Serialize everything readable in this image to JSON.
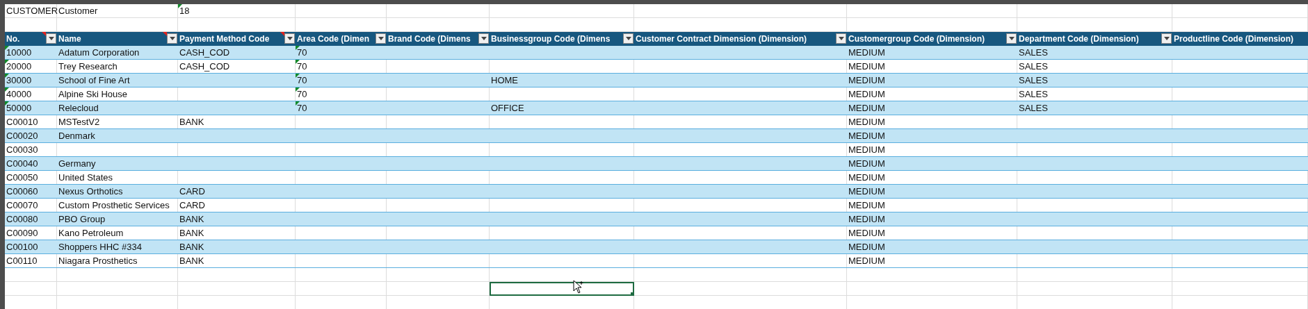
{
  "top_row": [
    {
      "text": "CUSTOMER",
      "flagged": false
    },
    {
      "text": "Customer",
      "flagged": false
    },
    {
      "text": "18",
      "flagged": true
    }
  ],
  "table": {
    "columns": [
      {
        "label": "No.",
        "filter": true,
        "comment": true
      },
      {
        "label": "Name",
        "filter": true,
        "comment": true
      },
      {
        "label": "Payment Method Code",
        "filter": true,
        "comment": true
      },
      {
        "label": "Area Code (Dimen",
        "filter": true,
        "comment": false
      },
      {
        "label": "Brand Code (Dimens",
        "filter": true,
        "comment": false
      },
      {
        "label": "Businessgroup Code (Dimens",
        "filter": true,
        "comment": false
      },
      {
        "label": "Customer Contract Dimension (Dimension)",
        "filter": true,
        "comment": false
      },
      {
        "label": "Customergroup Code (Dimension)",
        "filter": true,
        "comment": false
      },
      {
        "label": "Department Code (Dimension)",
        "filter": true,
        "comment": false
      },
      {
        "label": "Productline Code (Dimension)",
        "filter": false,
        "comment": false
      }
    ],
    "rows": [
      {
        "no": "10000",
        "name": "Adatum Corporation",
        "payment_method": "CASH_COD",
        "area": "70",
        "customergroup": "MEDIUM",
        "department": "SALES",
        "flagged": true
      },
      {
        "no": "20000",
        "name": "Trey Research",
        "payment_method": "CASH_COD",
        "area": "70",
        "customergroup": "MEDIUM",
        "department": "SALES",
        "flagged": true
      },
      {
        "no": "30000",
        "name": "School of Fine Art",
        "area": "70",
        "businessgroup": "HOME",
        "customergroup": "MEDIUM",
        "department": "SALES",
        "flagged": true
      },
      {
        "no": "40000",
        "name": "Alpine Ski House",
        "area": "70",
        "customergroup": "MEDIUM",
        "department": "SALES",
        "flagged": true
      },
      {
        "no": "50000",
        "name": "Relecloud",
        "area": "70",
        "businessgroup": "OFFICE",
        "customergroup": "MEDIUM",
        "department": "SALES",
        "flagged": true
      },
      {
        "no": "C00010",
        "name": "MSTestV2",
        "payment_method": "BANK",
        "customergroup": "MEDIUM",
        "flagged": false
      },
      {
        "no": "C00020",
        "name": "Denmark",
        "customergroup": "MEDIUM",
        "flagged": false
      },
      {
        "no": "C00030",
        "customergroup": "MEDIUM",
        "flagged": false
      },
      {
        "no": "C00040",
        "name": "Germany",
        "customergroup": "MEDIUM",
        "flagged": false
      },
      {
        "no": "C00050",
        "name": "United States",
        "customergroup": "MEDIUM",
        "flagged": false
      },
      {
        "no": "C00060",
        "name": "Nexus Orthotics",
        "payment_method": "CARD",
        "customergroup": "MEDIUM",
        "flagged": false
      },
      {
        "no": "C00070",
        "name": "Custom Prosthetic Services",
        "payment_method": "CARD",
        "customergroup": "MEDIUM",
        "flagged": false
      },
      {
        "no": "C00080",
        "name": "PBO Group",
        "payment_method": "BANK",
        "customergroup": "MEDIUM",
        "flagged": false
      },
      {
        "no": "C00090",
        "name": "Kano Petroleum",
        "payment_method": "BANK",
        "customergroup": "MEDIUM",
        "flagged": false
      },
      {
        "no": "C00100",
        "name": "Shoppers HHC #334",
        "payment_method": "BANK",
        "customergroup": "MEDIUM",
        "flagged": false
      },
      {
        "no": "C00110",
        "name": "Niagara Prosthetics",
        "payment_method": "BANK",
        "customergroup": "MEDIUM",
        "flagged": false
      }
    ]
  },
  "blank_rows": [
    {
      "selected_cells": [
        false,
        false,
        false,
        false,
        false,
        false,
        false,
        false,
        false,
        false
      ]
    },
    {
      "selected_cells": [
        false,
        false,
        false,
        false,
        false,
        true,
        false,
        false,
        false,
        false
      ]
    }
  ]
}
